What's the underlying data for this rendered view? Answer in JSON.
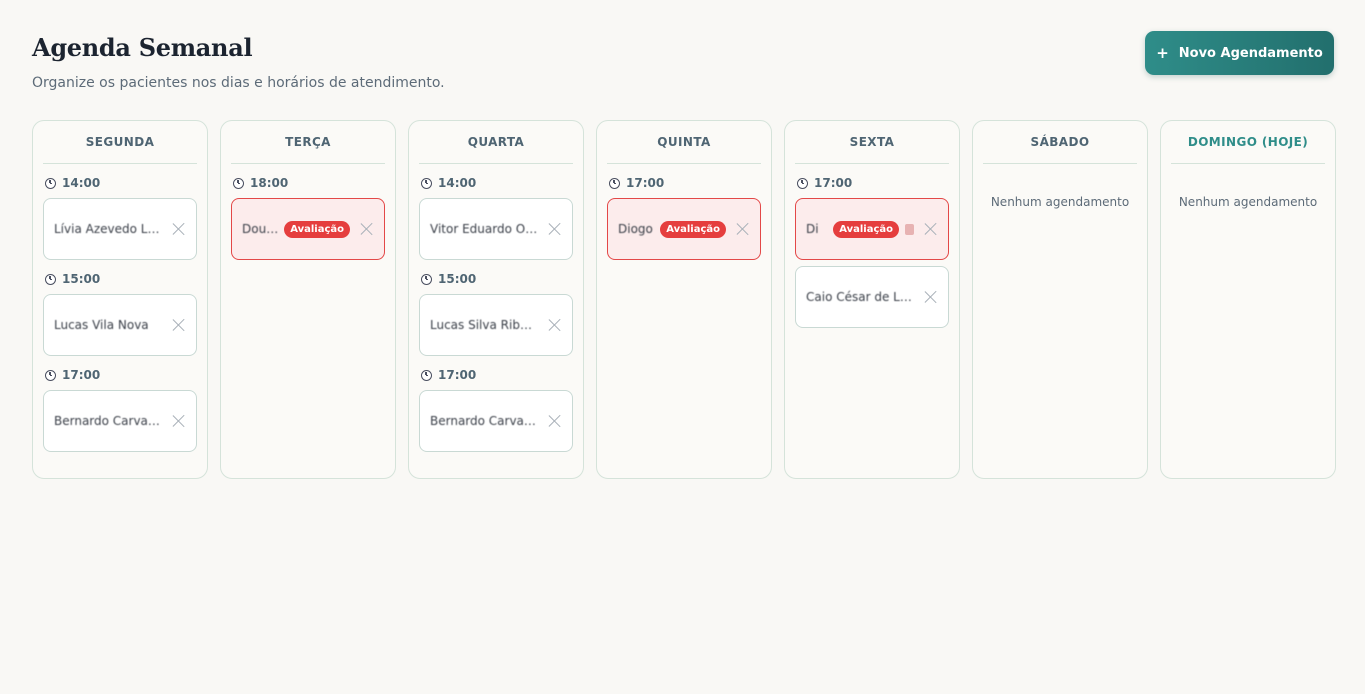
{
  "header": {
    "title": "Agenda Semanal",
    "subtitle": "Organize os pacientes nos dias e horários de atendimento.",
    "new_button_icon": "plus-icon",
    "new_button_label": "Novo Agendamento"
  },
  "colors": {
    "accent": "#2f8d89",
    "evaluation": "#e53e3e",
    "evaluation_bg": "#fcecec"
  },
  "days": [
    {
      "name": "SEGUNDA",
      "today": false,
      "empty_text": "",
      "slots": [
        {
          "time": "14:00",
          "cards": [
            {
              "patient": "Lívia Azevedo Lima",
              "badge": "",
              "note": false
            }
          ]
        },
        {
          "time": "15:00",
          "cards": [
            {
              "patient": "Lucas Vila Nova",
              "badge": "",
              "note": false
            }
          ]
        },
        {
          "time": "17:00",
          "cards": [
            {
              "patient": "Bernardo Carvalho",
              "badge": "",
              "note": false
            }
          ]
        }
      ]
    },
    {
      "name": "TERÇA",
      "today": false,
      "empty_text": "",
      "slots": [
        {
          "time": "18:00",
          "cards": [
            {
              "patient": "Douglas",
              "badge": "Avaliação",
              "note": false
            }
          ]
        }
      ]
    },
    {
      "name": "QUARTA",
      "today": false,
      "empty_text": "",
      "slots": [
        {
          "time": "14:00",
          "cards": [
            {
              "patient": "Vitor Eduardo Oliveira",
              "badge": "",
              "note": false
            }
          ]
        },
        {
          "time": "15:00",
          "cards": [
            {
              "patient": "Lucas Silva Ribeiro",
              "badge": "",
              "note": false
            }
          ]
        },
        {
          "time": "17:00",
          "cards": [
            {
              "patient": "Bernardo Carvalho",
              "badge": "",
              "note": false
            }
          ]
        }
      ]
    },
    {
      "name": "QUINTA",
      "today": false,
      "empty_text": "",
      "slots": [
        {
          "time": "17:00",
          "cards": [
            {
              "patient": "Diogo",
              "badge": "Avaliação",
              "note": false
            }
          ]
        }
      ]
    },
    {
      "name": "SEXTA",
      "today": false,
      "empty_text": "",
      "slots": [
        {
          "time": "17:00",
          "cards": [
            {
              "patient": "Di",
              "badge": "Avaliação",
              "note": true
            },
            {
              "patient": "Caio César de Lima",
              "badge": "",
              "note": false
            }
          ]
        }
      ]
    },
    {
      "name": "SÁBADO",
      "today": false,
      "empty_text": "Nenhum agendamento",
      "slots": []
    },
    {
      "name": "DOMINGO (HOJE)",
      "today": true,
      "empty_text": "Nenhum agendamento",
      "slots": []
    }
  ]
}
